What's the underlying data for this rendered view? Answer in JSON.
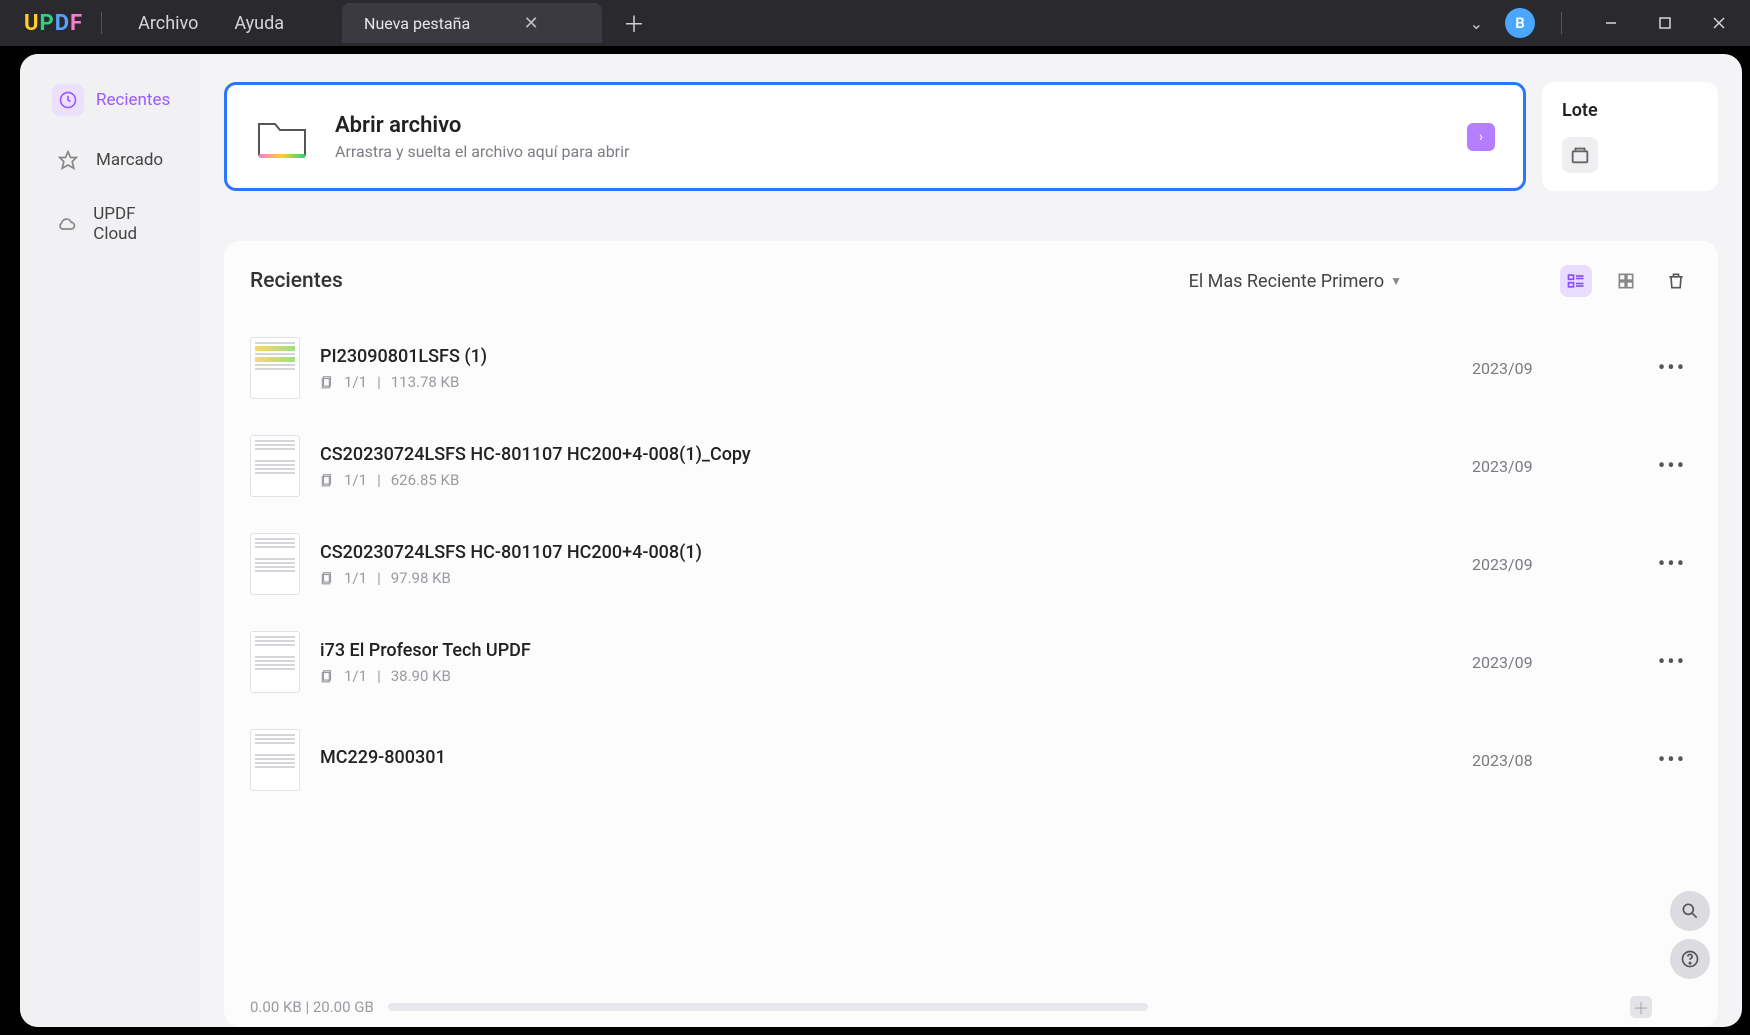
{
  "titlebar": {
    "menu_file": "Archivo",
    "menu_help": "Ayuda",
    "tab_label": "Nueva pestaña",
    "avatar_initial": "B"
  },
  "sidebar": {
    "items": [
      {
        "label": "Recientes"
      },
      {
        "label": "Marcado"
      },
      {
        "label": "UPDF Cloud"
      }
    ]
  },
  "open_card": {
    "title": "Abrir archivo",
    "subtitle": "Arrastra y suelta el archivo aquí para abrir"
  },
  "batch": {
    "title": "Lote"
  },
  "recents": {
    "title": "Recientes",
    "sort_label": "El Mas Reciente Primero"
  },
  "files": [
    {
      "name": "PI23090801LSFS (1)",
      "pages": "1/1",
      "size": "113.78 KB",
      "date": "2023/09"
    },
    {
      "name": "CS20230724LSFS      HC-801107   HC200+4-008(1)_Copy",
      "pages": "1/1",
      "size": "626.85 KB",
      "date": "2023/09"
    },
    {
      "name": "CS20230724LSFS      HC-801107   HC200+4-008(1)",
      "pages": "1/1",
      "size": "97.98 KB",
      "date": "2023/09"
    },
    {
      "name": "i73 El Profesor Tech UPDF",
      "pages": "1/1",
      "size": "38.90 KB",
      "date": "2023/09"
    },
    {
      "name": "MC229-800301",
      "pages": "",
      "size": "",
      "date": "2023/08"
    }
  ],
  "storage": {
    "text": "0.00 KB | 20.00 GB"
  }
}
